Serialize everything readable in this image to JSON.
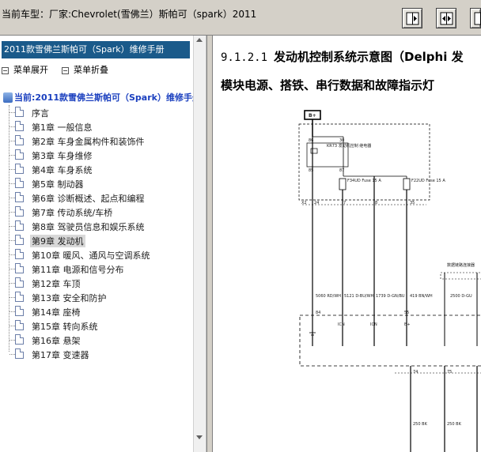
{
  "window": {
    "title": "当前车型：厂家:Chevrolet(雪佛兰）斯帕可（spark）2011",
    "nav_buttons": [
      {
        "name": "prev-icon"
      },
      {
        "name": "split-view-icon"
      },
      {
        "name": "next-icon"
      }
    ]
  },
  "sidebar": {
    "manual_title": "2011款雪佛兰斯帕可（Spark）维修手册",
    "expand_label": "菜单展开",
    "collapse_label": "菜单折叠",
    "root_label": "当前:2011款雪佛兰斯帕可（Spark）维修手册",
    "selected_index": 10,
    "items": [
      {
        "label": "序言"
      },
      {
        "label": "第1章 一般信息"
      },
      {
        "label": "第2章 车身金属构件和装饰件"
      },
      {
        "label": "第3章 车身维修"
      },
      {
        "label": "第4章 车身系统"
      },
      {
        "label": "第5章 制动器"
      },
      {
        "label": "第6章 诊断概述、起点和编程"
      },
      {
        "label": "第7章 传动系统/车桥"
      },
      {
        "label": "第8章 驾驶员信息和娱乐系统"
      },
      {
        "label": "第9章 发动机"
      },
      {
        "label": "第10章 暖风、通风与空调系统"
      },
      {
        "label": "第11章 电源和信号分布"
      },
      {
        "label": "第12章 车顶"
      },
      {
        "label": "第13章 安全和防护"
      },
      {
        "label": "第14章 座椅"
      },
      {
        "label": "第15章 转向系统"
      },
      {
        "label": "第16章 悬架"
      },
      {
        "label": "第17章 变速器"
      }
    ]
  },
  "content": {
    "section_number": "9.1.2.1",
    "section_title": "发动机控制系统示意图（Delphi 发",
    "subtitle": "模块电源、搭铁、串行数据和故障指示灯",
    "diagram": {
      "top_label": "B+",
      "relay_label": "KR73 发动机控制 继电器",
      "fuse_left": "F34UD Fuse 15 A",
      "fuse_right": "F22UD Fuse 15 A",
      "pin_top": [
        "86",
        "85",
        "30",
        "87"
      ],
      "connector_top": "X2",
      "connector_pins_top": [
        "24",
        "7",
        "8",
        "35"
      ],
      "wires": [
        "5060 RD/WH",
        "5121 D-BU/WH",
        "1739 D-GN/BU",
        "419 BN/WH",
        "2500 D-GU"
      ],
      "pins_bottom": [
        "84",
        "ICN",
        "ICN",
        "55",
        "B+"
      ],
      "lower_pins": [
        "74",
        "75"
      ],
      "lower_wires": [
        "250 BK",
        "250 BK"
      ],
      "right_box_label": "数据链路连接器"
    }
  },
  "colors": {
    "header_bg": "#1a5a8a",
    "toolbar_bg": "#d4d0c8",
    "root_label": "#1a3fbf"
  }
}
